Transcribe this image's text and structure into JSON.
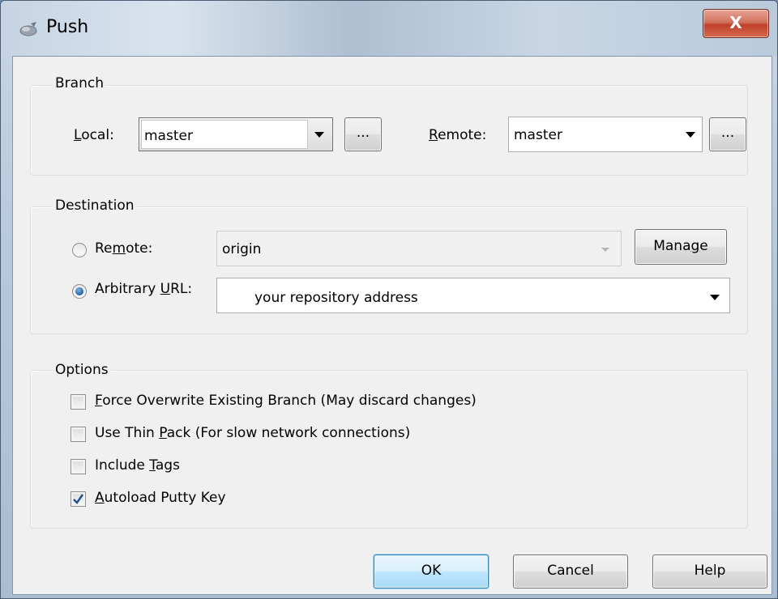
{
  "window": {
    "title": "Push",
    "close_glyph": "X"
  },
  "branch": {
    "group_label": "Branch",
    "local_label_pre": "",
    "local_label_accel": "L",
    "local_label_post": "ocal:",
    "local_value": "master",
    "local_browse": "...",
    "remote_label_pre": "",
    "remote_label_accel": "R",
    "remote_label_post": "emote:",
    "remote_value": "master",
    "remote_browse": "..."
  },
  "destination": {
    "group_label": "Destination",
    "remote_option_pre": "Re",
    "remote_option_accel": "m",
    "remote_option_post": "ote:",
    "remote_option_selected": false,
    "remote_value": "origin",
    "manage_pre": "Mana",
    "manage_accel": "g",
    "manage_post": "e",
    "url_option_pre": "Arbitrary ",
    "url_option_accel": "U",
    "url_option_post": "RL:",
    "url_option_selected": true,
    "url_value": "your repository address"
  },
  "options": {
    "group_label": "Options",
    "items": [
      {
        "pre": "",
        "accel": "F",
        "post": "orce Overwrite Existing Branch (May discard changes)",
        "checked": false
      },
      {
        "pre": "Use Thin ",
        "accel": "P",
        "post": "ack (For slow network connections)",
        "checked": false
      },
      {
        "pre": "Include ",
        "accel": "T",
        "post": "ags",
        "checked": false
      },
      {
        "pre": "",
        "accel": "A",
        "post": "utoload Putty Key",
        "checked": true
      }
    ]
  },
  "buttons": {
    "ok": "OK",
    "cancel": "Cancel",
    "help": "Help"
  },
  "icons": {
    "title": "push-icon",
    "close": "close-icon",
    "combo_arrow": "chevron-down-icon",
    "check": "checkmark-icon"
  }
}
